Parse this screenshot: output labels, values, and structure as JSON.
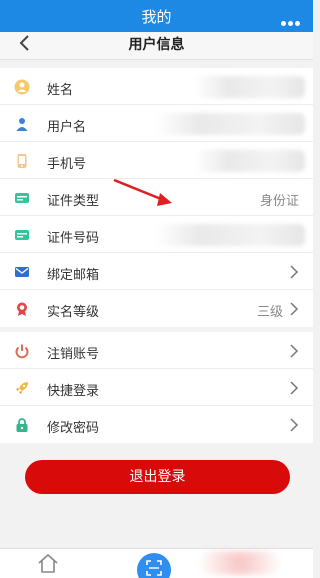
{
  "app": {
    "title": "我的"
  },
  "header": {
    "title": "用户信息"
  },
  "profile_rows": [
    {
      "label": "姓名",
      "value": "",
      "icon": "person-icon"
    },
    {
      "label": "用户名",
      "value": "",
      "icon": "user-icon"
    },
    {
      "label": "手机号",
      "value": "",
      "icon": "phone-icon"
    },
    {
      "label": "证件类型",
      "value": "身份证",
      "icon": "id-card-icon"
    },
    {
      "label": "证件号码",
      "value": "",
      "icon": "id-number-icon"
    },
    {
      "label": "绑定邮箱",
      "value": "",
      "icon": "mail-icon"
    },
    {
      "label": "实名等级",
      "value": "三级",
      "icon": "badge-icon"
    }
  ],
  "account_rows": [
    {
      "label": "注销账号",
      "icon": "power-icon"
    },
    {
      "label": "快捷登录",
      "icon": "rocket-icon"
    },
    {
      "label": "修改密码",
      "icon": "lock-icon"
    }
  ],
  "logout": {
    "label": "退出登录"
  },
  "colors": {
    "primary": "#1e88e5",
    "danger": "#d90a0a",
    "annotation": "#e02020"
  }
}
